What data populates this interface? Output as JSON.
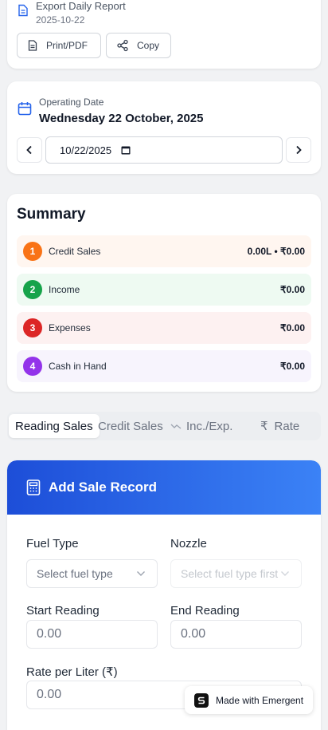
{
  "export": {
    "title": "Export Daily Report",
    "date": "2025-10-22",
    "print_label": "Print/PDF",
    "copy_label": "Copy"
  },
  "operating": {
    "label": "Operating Date",
    "value": "Wednesday 22 October, 2025",
    "input_value": "10/22/2025"
  },
  "summary": {
    "title": "Summary",
    "rows": [
      {
        "num": "1",
        "label": "Credit Sales",
        "value": "0.00L • ₹0.00",
        "badge_color": "#f97316",
        "bg": "#fff6f0"
      },
      {
        "num": "2",
        "label": "Income",
        "value": "₹0.00",
        "badge_color": "#16a34a",
        "bg": "#eefaf2"
      },
      {
        "num": "3",
        "label": "Expenses",
        "value": "₹0.00",
        "badge_color": "#dc2626",
        "bg": "#fdf1f1"
      },
      {
        "num": "4",
        "label": "Cash in Hand",
        "value": "₹0.00",
        "badge_color": "#9333ea",
        "bg": "#f7f4fd"
      }
    ]
  },
  "tabs": {
    "reading": "Reading Sales",
    "credit": "Credit Sales",
    "inc": "Inc./Exp.",
    "rate": "Rate",
    "active": "reading"
  },
  "sale": {
    "title": "Add Sale Record",
    "fuel_type_label": "Fuel Type",
    "fuel_type_placeholder": "Select fuel type",
    "nozzle_label": "Nozzle",
    "nozzle_placeholder": "Select fuel type first",
    "start_label": "Start Reading",
    "start_placeholder": "0.00",
    "end_label": "End Reading",
    "end_placeholder": "0.00",
    "rate_label": "Rate per Liter (₹)",
    "rate_placeholder": "0.00"
  },
  "badge": {
    "label": "Made with Emergent"
  },
  "colors": {
    "primary": "#1d4ed8",
    "accent": "#3b82f6",
    "icon_blue": "#2563eb"
  }
}
